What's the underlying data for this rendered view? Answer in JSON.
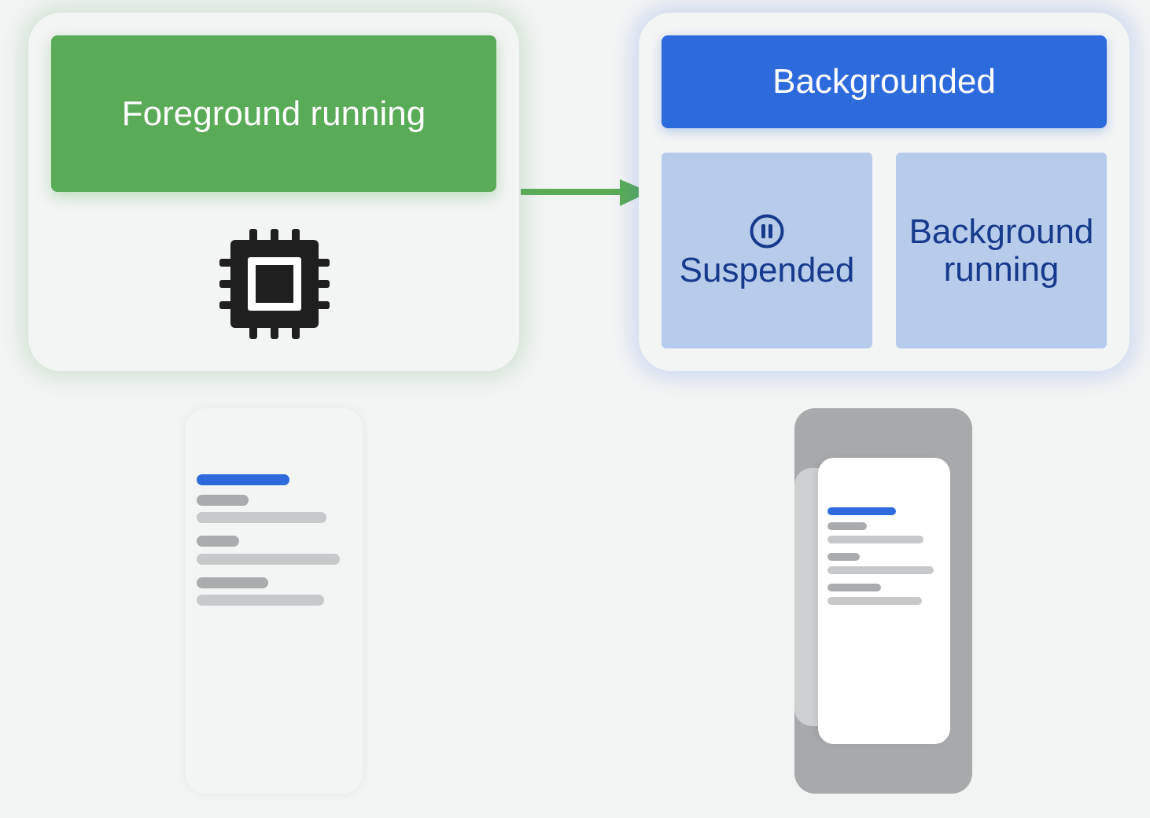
{
  "foreground": {
    "title": "Foreground running",
    "icon": "cpu-chip-icon",
    "accent_color": "#5aab58"
  },
  "backgrounded": {
    "title": "Backgrounded",
    "accent_color": "#2d6bdc",
    "suspended": {
      "label": "Suspended",
      "icon": "pause-circle-icon"
    },
    "background_running": {
      "label_line1": "Background",
      "label_line2": "running"
    }
  },
  "transition_arrow": {
    "color": "#5aab58",
    "from": "foreground",
    "to": "backgrounded"
  }
}
